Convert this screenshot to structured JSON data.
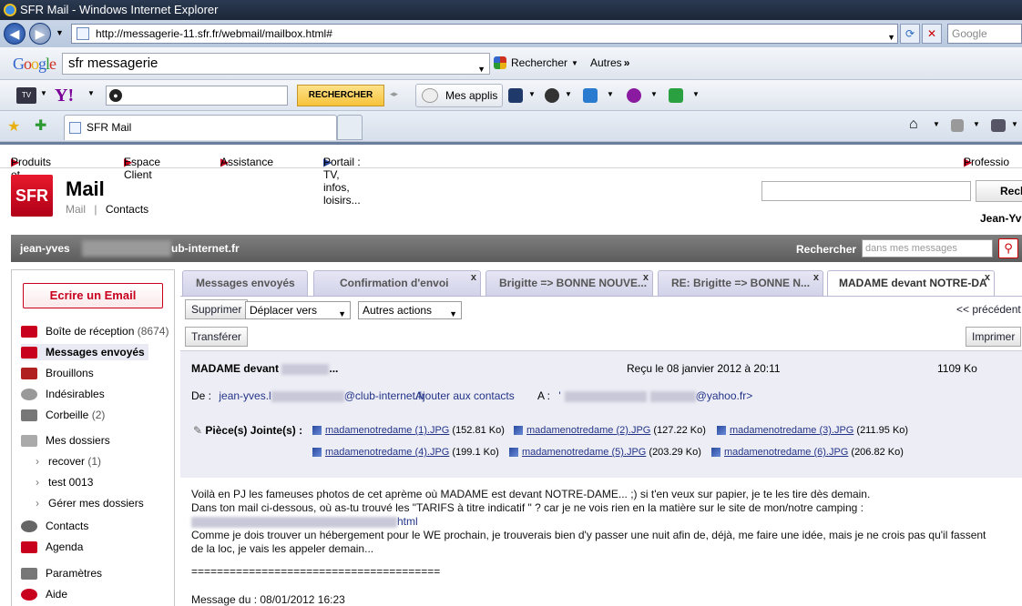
{
  "window": {
    "title": "SFR Mail - Windows Internet Explorer"
  },
  "browser": {
    "address": "http://messagerie-11.sfr.fr/webmail/mailbox.html#",
    "search_placeholder": "Google",
    "google_query": "sfr messagerie",
    "google_search_label": "Rechercher",
    "google_more_label": "Autres",
    "yahoo_search_label": "RECHERCHER",
    "mes_applis_label": "Mes applis",
    "tab_title": "SFR Mail"
  },
  "site": {
    "topnav": [
      "Produits et Offres",
      "Espace Client",
      "Assistance",
      "Portail : TV, infos, loisirs...",
      "Professio"
    ],
    "logo_text": "SFR",
    "app_title": "Mail",
    "subnav_mail": "Mail",
    "subnav_separator": "|",
    "subnav_contacts": "Contacts",
    "top_search_button": "Rech",
    "user_short": "Jean-Yv",
    "user_email_start": "jean-yves",
    "user_email_end": "ub-internet.fr",
    "search_label": "Rechercher",
    "search_placeholder": "dans mes messages"
  },
  "sidebar": {
    "compose_label": "Ecrire un Email",
    "items": [
      {
        "label": "Boîte de réception",
        "count": "(8674)"
      },
      {
        "label": "Messages envoyés",
        "count": ""
      },
      {
        "label": "Brouillons",
        "count": ""
      },
      {
        "label": "Indésirables",
        "count": ""
      },
      {
        "label": "Corbeille",
        "count": "(2)"
      },
      {
        "label": "Mes dossiers",
        "count": ""
      },
      {
        "label": "recover",
        "count": "(1)"
      },
      {
        "label": "test 0013",
        "count": ""
      },
      {
        "label": "Gérer mes dossiers",
        "count": ""
      },
      {
        "label": "Contacts",
        "count": ""
      },
      {
        "label": "Agenda",
        "count": ""
      },
      {
        "label": "Paramètres",
        "count": ""
      },
      {
        "label": "Aide",
        "count": ""
      }
    ]
  },
  "tabs": [
    {
      "label": "Messages envoyés",
      "close": ""
    },
    {
      "label": "Confirmation d'envoi",
      "close": "x"
    },
    {
      "label": "Brigitte => BONNE NOUVE...",
      "close": "x"
    },
    {
      "label": "RE: Brigitte => BONNE N...",
      "close": "x"
    },
    {
      "label": "MADAME devant NOTRE-DA",
      "close": "x"
    }
  ],
  "actions": {
    "delete": "Supprimer",
    "move_to": "Déplacer vers",
    "other_actions": "Autres actions",
    "previous": "<< précédent",
    "forward": "Transférer",
    "print": "Imprimer"
  },
  "message": {
    "subject": "MADAME devant",
    "subject_end": "...",
    "received": "Reçu le 08 janvier 2012 à 20:11",
    "size": "1109 Ko",
    "from_label": "De :",
    "from_start": "jean-yves.l",
    "from_end": "@club-internet.fr",
    "add_contact": "Ajouter aux contacts",
    "to_label": "A :",
    "to_start": "'",
    "to_end": "@yahoo.fr>",
    "attachments_label": "Pièce(s) Jointe(s) :",
    "attachments": [
      {
        "name": "madamenotredame (1).JPG",
        "size": "(152.81 Ko)"
      },
      {
        "name": "madamenotredame (2).JPG",
        "size": "(127.22 Ko)"
      },
      {
        "name": "madamenotredame (3).JPG",
        "size": "(211.95 Ko)"
      },
      {
        "name": "madamenotredame (4).JPG",
        "size": "(199.1 Ko)"
      },
      {
        "name": "madamenotredame (5).JPG",
        "size": "(203.29 Ko)"
      },
      {
        "name": "madamenotredame (6).JPG",
        "size": "(206.82 Ko)"
      }
    ],
    "body": [
      "Voilà en PJ les fameuses photos de cet aprème où MADAME est devant NOTRE-DAME...  ;) si t'en veux sur papier, je te les tire dès demain.",
      "Dans ton mail ci-dessous, où as-tu trouvé les \"TARIFS à titre indicatif \"  ? car je ne vois rien en la matière sur le site de mon/notre camping :",
      "html",
      "Comme je dois trouver un hébergement pour le WE prochain, je trouverais bien d'y passer une nuit afin de, déjà, me faire une idée, mais je ne crois pas qu'il fassent",
      "de la loc, je vais les appeler demain...",
      "=======================================",
      "Message du : 08/01/2012 16:23"
    ]
  },
  "icons": {
    "back": "arrow-left",
    "forward": "arrow-right",
    "refresh": "refresh",
    "stop": "close",
    "home": "home",
    "rss": "rss",
    "print": "printer",
    "search": "magnifier"
  },
  "colors": {
    "sfr_red": "#c8001e",
    "link": "#223388"
  }
}
